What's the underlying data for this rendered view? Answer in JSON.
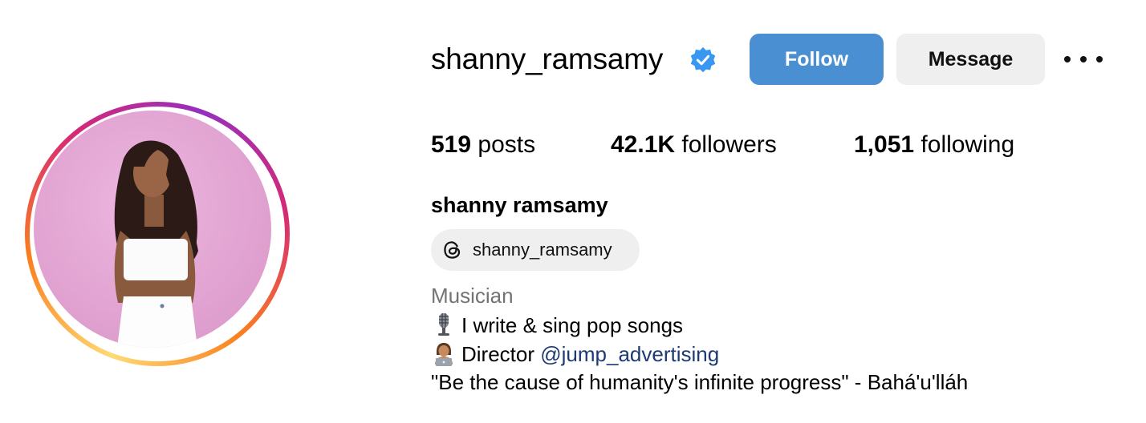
{
  "profile": {
    "username": "shanny_ramsamy",
    "verified": true,
    "full_name": "shanny ramsamy",
    "threads_handle": "shanny_ramsamy",
    "category": "Musician"
  },
  "actions": {
    "follow_label": "Follow",
    "message_label": "Message",
    "more_icon": "more-horizontal-icon"
  },
  "stats": {
    "posts_count": "519",
    "posts_label": "posts",
    "followers_count": "42.1K",
    "followers_label": "followers",
    "following_count": "1,051",
    "following_label": "following"
  },
  "bio": {
    "line1_icon": "microphone-emoji",
    "line1_text": "I write & sing pop songs",
    "line2_icon": "technologist-emoji",
    "line2_text": "Director",
    "line2_mention": "@jump_advertising",
    "line3_text": "\"Be the cause of humanity's infinite progress\" - Bahá'u'lláh"
  },
  "colors": {
    "follow_button": "#4a8fd1",
    "verified_badge": "#3897f0",
    "mention_link": "#1e3a73",
    "category_text": "#737373",
    "photo_background": "#e2a4d2"
  }
}
